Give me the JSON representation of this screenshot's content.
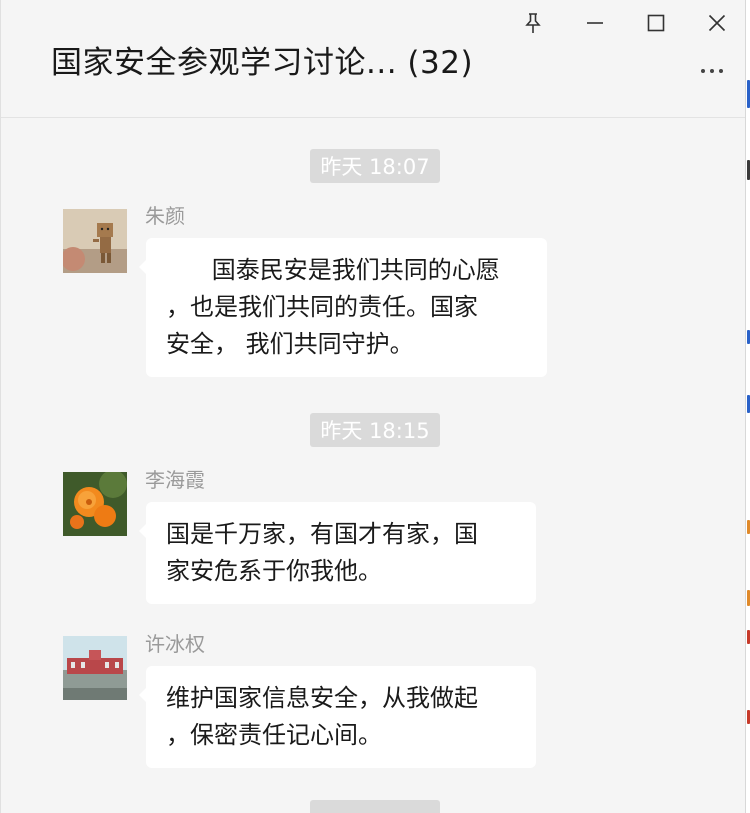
{
  "window": {
    "title": "国家安全参观学习讨论... (32)",
    "controls": [
      "pin-icon",
      "minimize-icon",
      "maximize-icon",
      "close-icon"
    ],
    "more_icon": "more-icon"
  },
  "colors": {
    "background": "#f5f5f5",
    "bubble": "#ffffff",
    "timestamp_bg": "#dadada",
    "timestamp_text": "#ffffff",
    "sender_name": "#9a9a9a"
  },
  "chat": {
    "timestamps": [
      "昨天 18:07",
      "昨天 18:15"
    ],
    "messages": [
      {
        "sender": "朱颜",
        "avatar": "avatar-doll-figure",
        "text": "      国泰民安是我们共同的心愿\n，也是我们共同的责任。国家\n安全， 我们共同守护。"
      },
      {
        "sender": "李海霞",
        "avatar": "avatar-orange-flower",
        "text": "国是千万家，有国才有家，国\n家安危系于你我他。"
      },
      {
        "sender": "许冰权",
        "avatar": "avatar-campus-building",
        "text": "维护国家信息安全，从我做起\n，保密责任记心间。"
      }
    ]
  }
}
